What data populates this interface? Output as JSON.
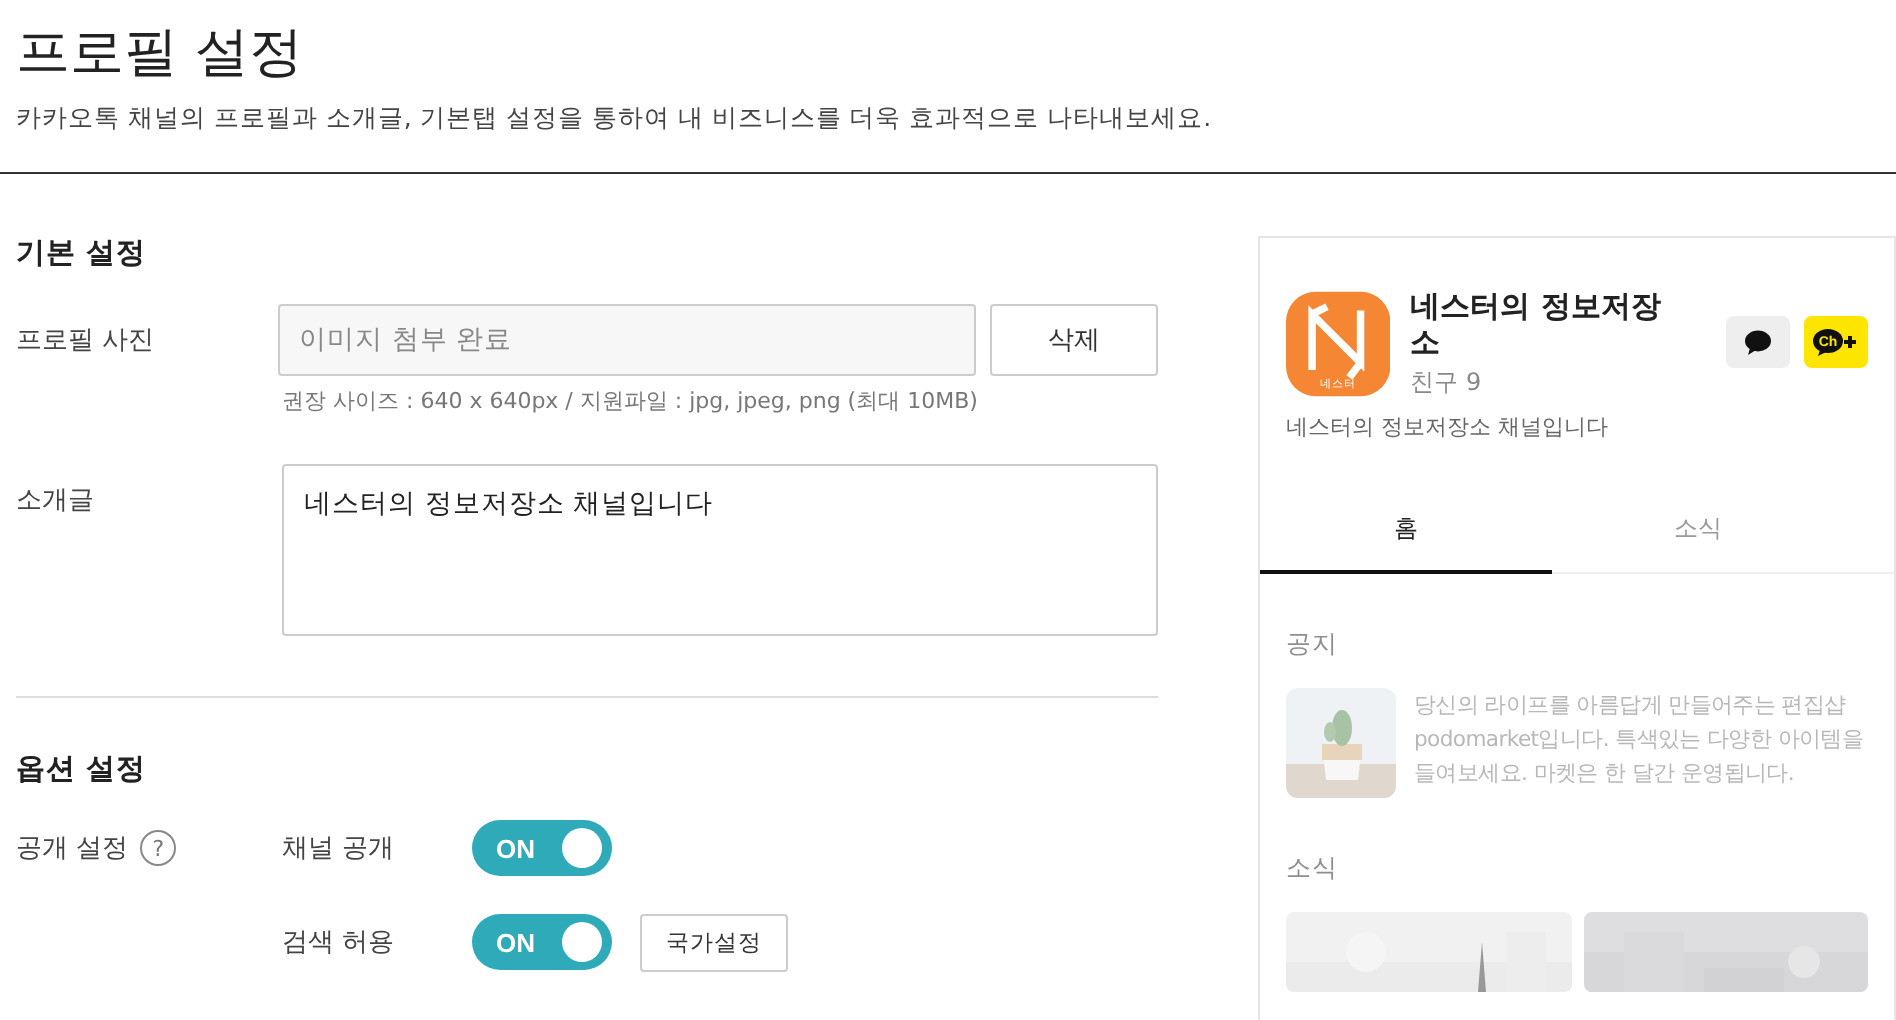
{
  "header": {
    "title": "프로필 설정",
    "subtitle": "카카오톡 채널의 프로필과 소개글, 기본탭 설정을 통하여 내 비즈니스를 더욱 효과적으로 나타내보세요."
  },
  "basic": {
    "heading": "기본 설정",
    "photo": {
      "label": "프로필 사진",
      "value": "이미지 첨부 완료",
      "button": "삭제",
      "hint": "권장 사이즈 : 640 x 640px / 지원파일 : jpg, jpeg, png (최대 10MB)"
    },
    "intro": {
      "label": "소개글",
      "value": "네스터의 정보저장소 채널입니다"
    }
  },
  "options": {
    "heading": "옵션 설정",
    "label": "공개 설정",
    "help": "?",
    "toggles": [
      {
        "label": "채널 공개",
        "on": true,
        "text": "ON"
      },
      {
        "label": "검색 허용",
        "on": true,
        "text": "ON",
        "button": "국가설정"
      }
    ]
  },
  "preview": {
    "logo_text": "네스터",
    "name": "네스터의 정보저장소",
    "friends": "친구 9",
    "description": "네스터의 정보저장소 채널입니다",
    "channel_add": "Ch",
    "tabs": [
      {
        "label": "홈",
        "selected": true
      },
      {
        "label": "소식",
        "selected": false
      }
    ],
    "notice": {
      "heading": "공지",
      "text": "당신의 라이프를 아름답게 만들어주는 편집샵 podomarket입니다. 특색있는 다양한 아이템을 들여보세요. 마켓은 한 달간 운영됩니다."
    },
    "news": {
      "heading": "소식"
    }
  }
}
